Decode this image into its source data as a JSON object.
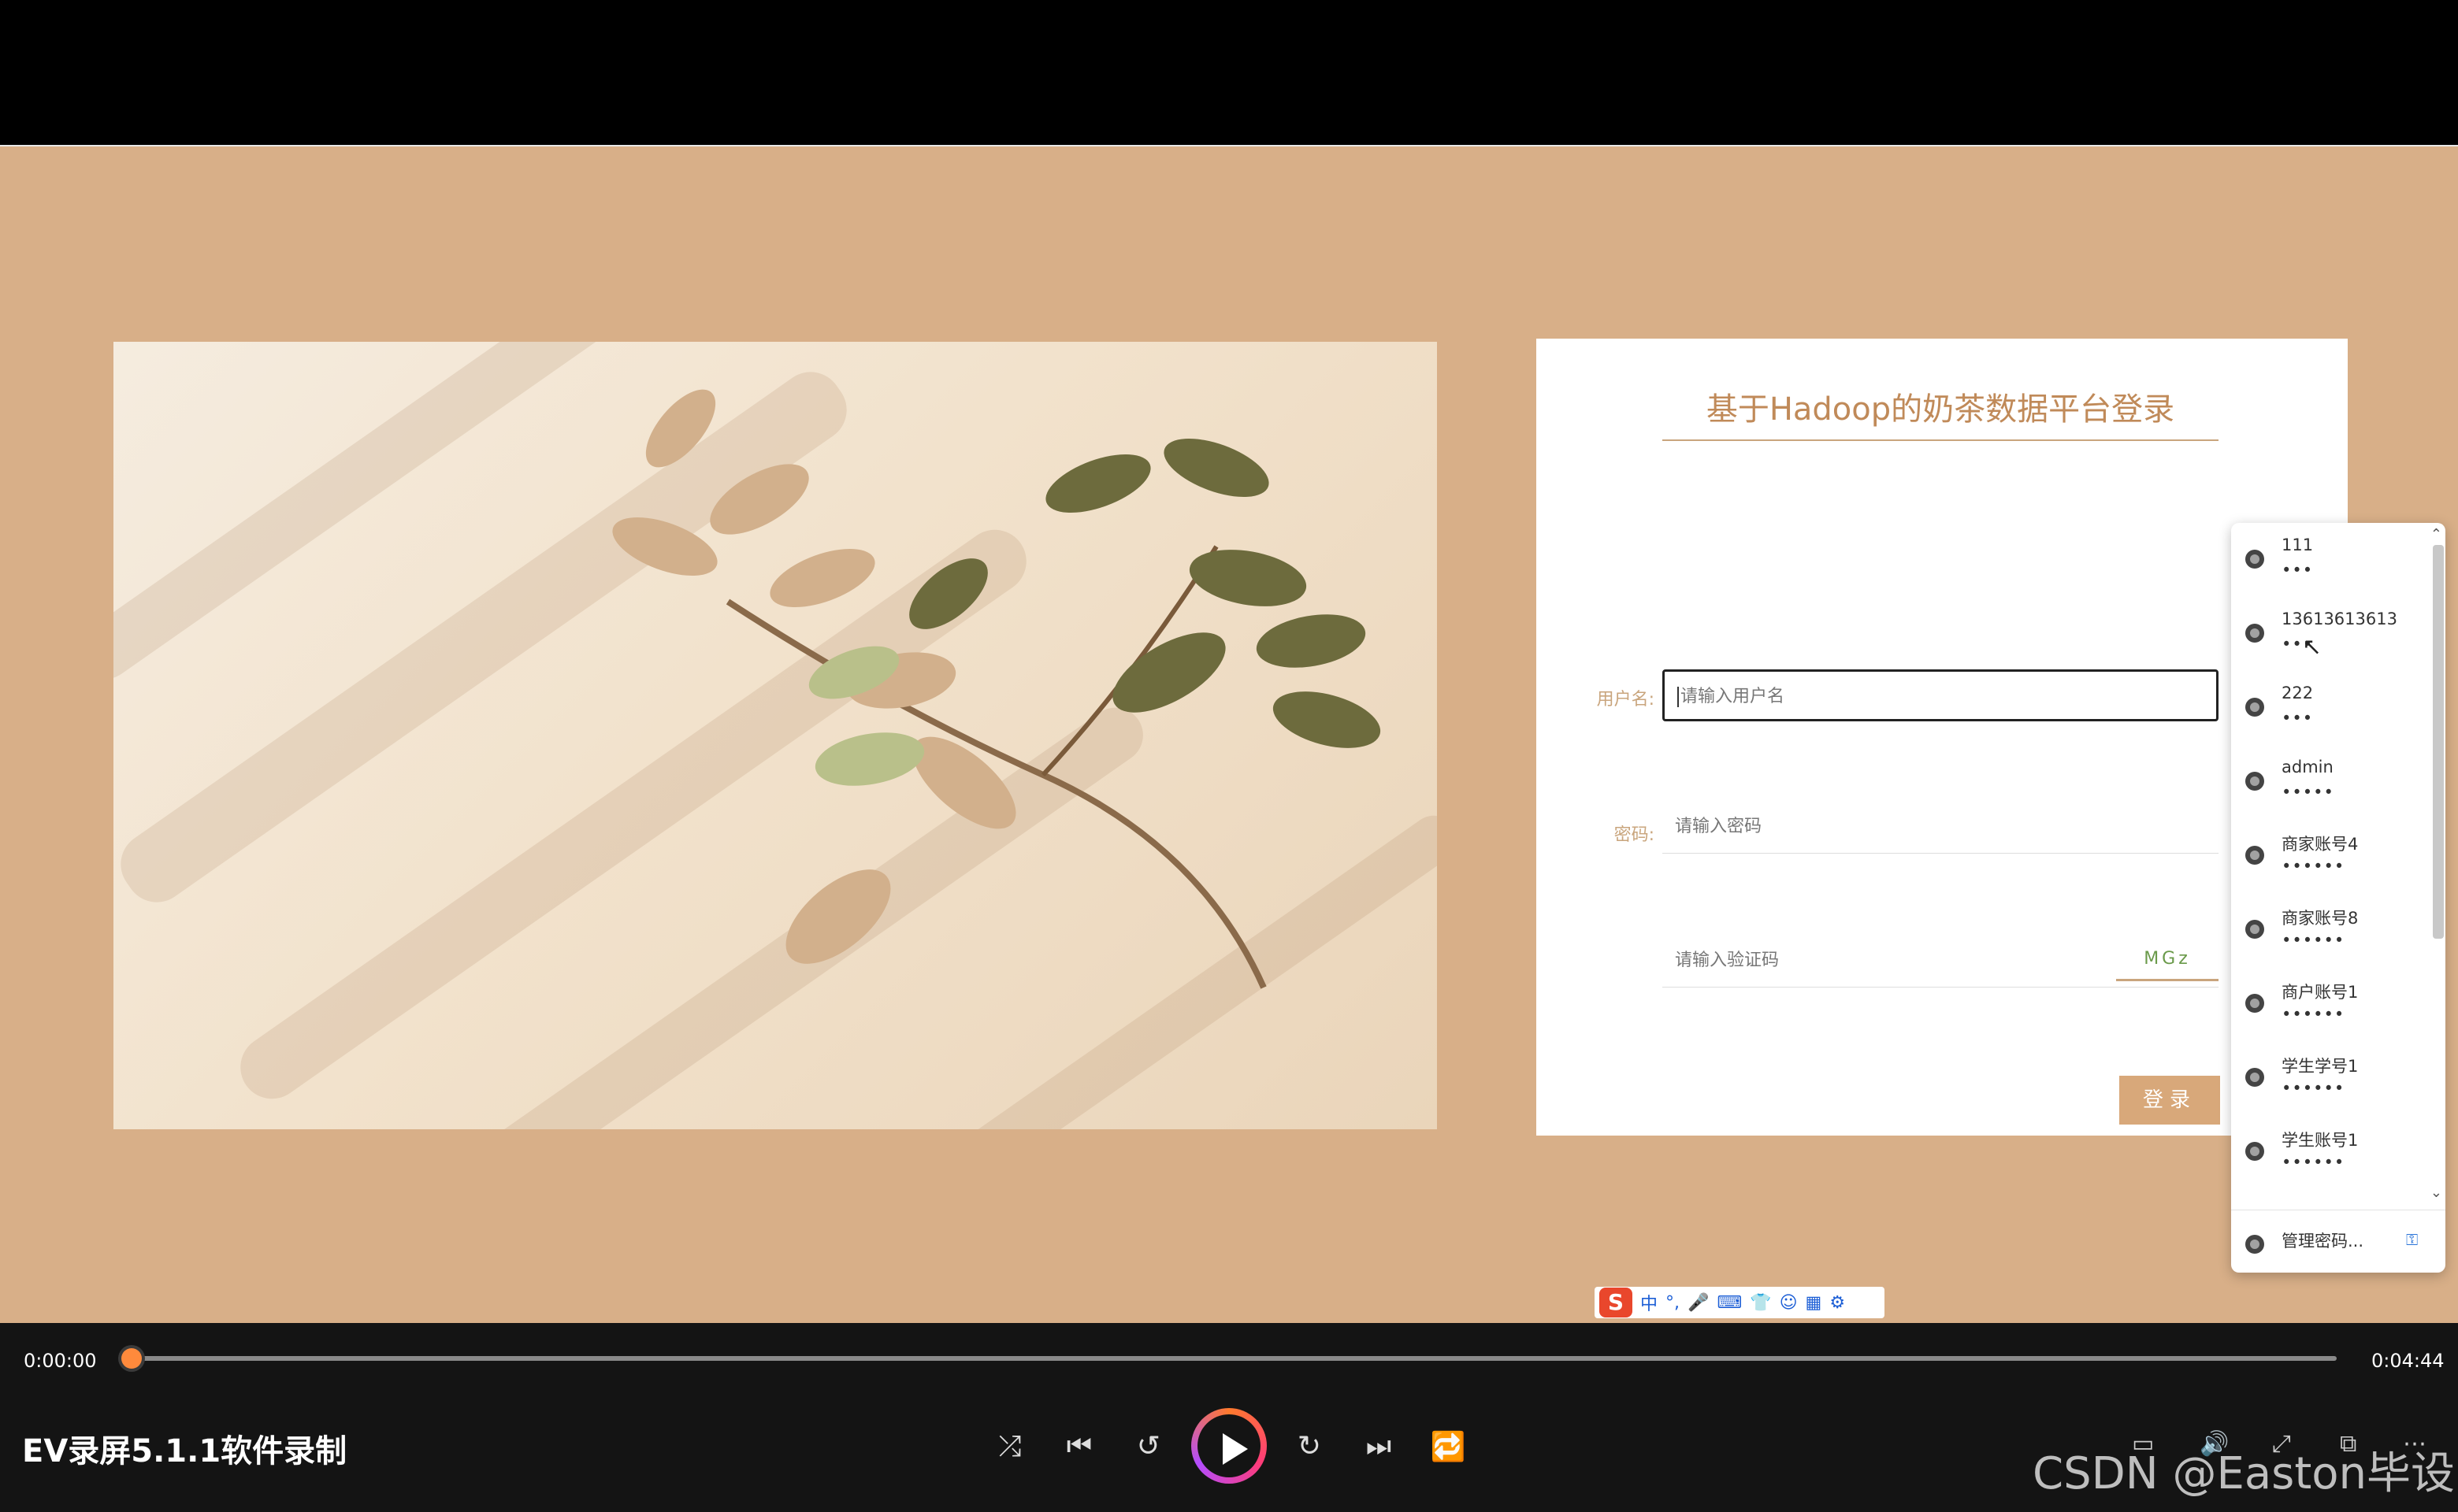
{
  "login": {
    "title": "基于Hadoop的奶茶数据平台登录",
    "username_label": "用户名:",
    "username_placeholder": "请输入用户名",
    "password_label": "密码:",
    "password_placeholder": "请输入密码",
    "captcha_placeholder": "请输入验证码",
    "captcha_text": "MGz",
    "submit_label": "登录"
  },
  "autofill": {
    "items": [
      {
        "user": "111",
        "pass": "•••"
      },
      {
        "user": "13613613613",
        "pass": "•••"
      },
      {
        "user": "222",
        "pass": "•••"
      },
      {
        "user": "admin",
        "pass": "•••••"
      },
      {
        "user": "商家账号4",
        "pass": "••••••"
      },
      {
        "user": "商家账号8",
        "pass": "••••••"
      },
      {
        "user": "商户账号1",
        "pass": "••••••"
      },
      {
        "user": "学生学号1",
        "pass": "••••••"
      },
      {
        "user": "学生账号1",
        "pass": "••••••"
      }
    ],
    "manage_label": "管理密码..."
  },
  "player": {
    "current_time": "0:00:00",
    "total_time": "0:04:44",
    "app_name": "EV录屏5.1.1软件录制",
    "progress": 0
  },
  "ime": {
    "icons": [
      "sogou-icon",
      "zh-icon",
      "punct-icon",
      "mic-icon",
      "keyboard-icon",
      "skin-icon",
      "emoji-icon",
      "apps-icon",
      "settings-icon"
    ]
  },
  "watermark": "CSDN @Easton毕设",
  "colors": {
    "accent": "#c08a59",
    "bg": "#d8af88",
    "button": "#d8a87a",
    "knob": "#ff8a3c"
  }
}
